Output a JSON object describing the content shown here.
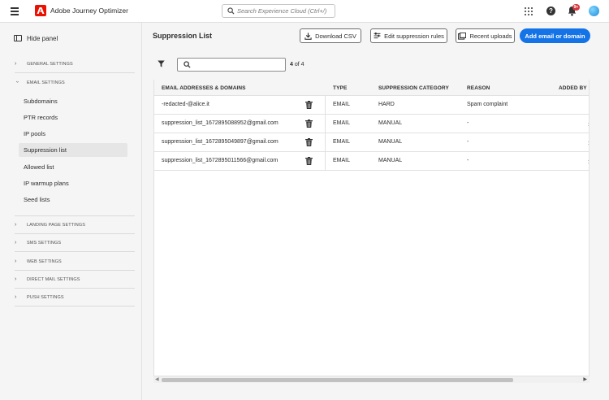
{
  "topbar": {
    "app_title": "Adobe Journey Optimizer",
    "search_placeholder": "Search Experience Cloud (Ctrl+/)",
    "notification_badge": "9+",
    "brand_color": "#eb1000"
  },
  "sidebar": {
    "hide_panel_label": "Hide panel",
    "sections": [
      {
        "label": "GENERAL SETTINGS",
        "expanded": false
      },
      {
        "label": "EMAIL SETTINGS",
        "expanded": true
      },
      {
        "label": "LANDING PAGE SETTINGS",
        "expanded": false
      },
      {
        "label": "SMS SETTINGS",
        "expanded": false
      },
      {
        "label": "WEB SETTINGS",
        "expanded": false
      },
      {
        "label": "DIRECT MAIL SETTINGS",
        "expanded": false
      },
      {
        "label": "PUSH SETTINGS",
        "expanded": false
      }
    ],
    "email_items": [
      {
        "label": "Subdomains",
        "active": false
      },
      {
        "label": "PTR records",
        "active": false
      },
      {
        "label": "IP pools",
        "active": false
      },
      {
        "label": "Suppression list",
        "active": true
      },
      {
        "label": "Allowed list",
        "active": false
      },
      {
        "label": "IP warmup plans",
        "active": false
      },
      {
        "label": "Seed lists",
        "active": false
      }
    ]
  },
  "main": {
    "title": "Suppression List",
    "buttons": {
      "download_csv": "Download CSV",
      "edit_rules": "Edit suppression rules",
      "recent_uploads": "Recent uploads",
      "add_email": "Add email or domain"
    },
    "accent_color": "#1473e6",
    "search_placeholder": "",
    "count_current": "4",
    "count_text": "of 4",
    "columns": [
      "EMAIL ADDRESSES & DOMAINS",
      "TYPE",
      "SUPPRESSION CATEGORY",
      "REASON",
      "ADDED BY"
    ],
    "rows": [
      {
        "email": "-redacted-@alice.it",
        "type": "EMAIL",
        "category": "HARD",
        "reason": "Spam complaint"
      },
      {
        "email": "suppression_list_1672895088952@gmail.com",
        "type": "EMAIL",
        "category": "MANUAL",
        "reason": "-"
      },
      {
        "email": "suppression_list_1672895049897@gmail.com",
        "type": "EMAIL",
        "category": "MANUAL",
        "reason": "-"
      },
      {
        "email": "suppression_list_1672895011566@gmail.com",
        "type": "EMAIL",
        "category": "MANUAL",
        "reason": "-"
      }
    ]
  }
}
